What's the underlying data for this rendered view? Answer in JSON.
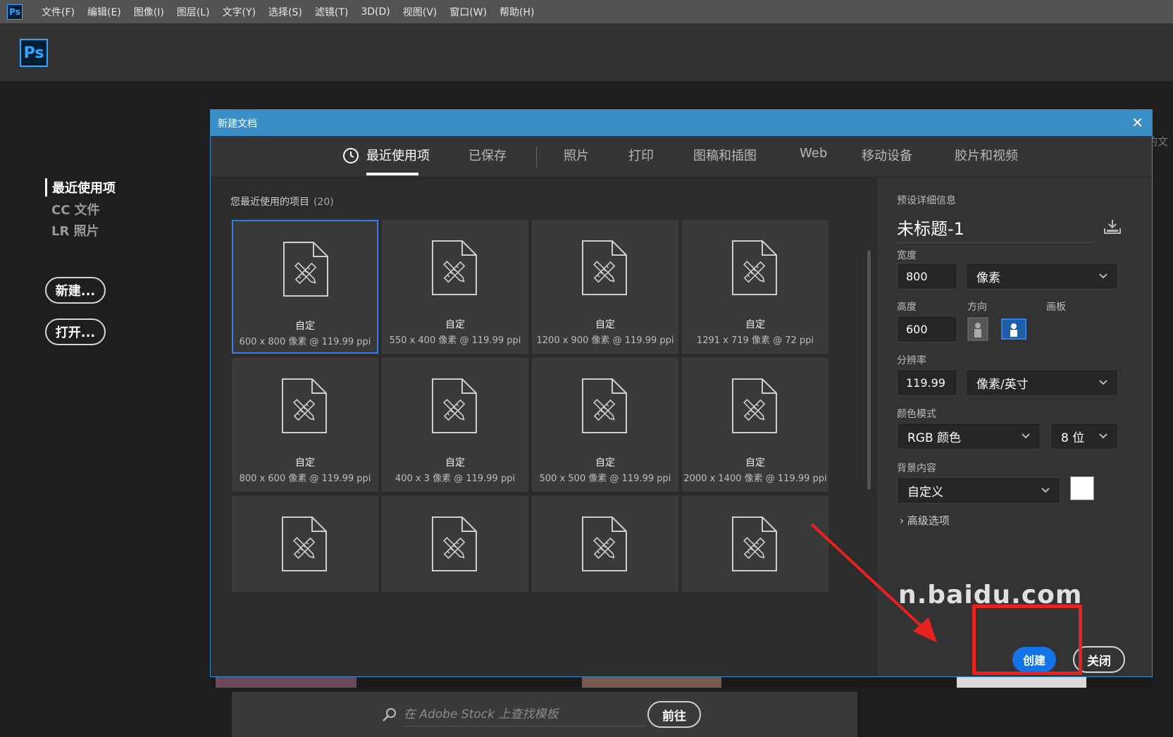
{
  "menubar": {
    "logo": "Ps",
    "items": [
      "文件(F)",
      "编辑(E)",
      "图像(I)",
      "图层(L)",
      "文字(Y)",
      "选择(S)",
      "滤镜(T)",
      "3D(D)",
      "视图(V)",
      "窗口(W)",
      "帮助(H)"
    ]
  },
  "header": {
    "logo": "Ps"
  },
  "start_panel": {
    "nav": [
      "最近使用项",
      "CC 文件",
      "LR 照片"
    ],
    "new_button": "新建...",
    "open_button": "打开..."
  },
  "background": {
    "right_fragment": "的文"
  },
  "dialog": {
    "title": "新建文档",
    "close_glyph": "✕",
    "tabs": [
      "最近使用项",
      "已保存",
      "照片",
      "打印",
      "图稿和插图",
      "Web",
      "移动设备",
      "胶片和视频"
    ],
    "active_tab": 0,
    "recent": {
      "heading": "您最近使用的项目",
      "count": "(20)",
      "items": [
        {
          "name": "自定",
          "size": "600 x 800 像素 @ 119.99 ppi",
          "selected": true
        },
        {
          "name": "自定",
          "size": "550 x 400 像素 @ 119.99 ppi"
        },
        {
          "name": "自定",
          "size": "1200 x 900 像素 @ 119.99 ppi"
        },
        {
          "name": "自定",
          "size": "1291 x 719 像素 @ 72 ppi"
        },
        {
          "name": "自定",
          "size": "800 x 600 像素 @ 119.99 ppi"
        },
        {
          "name": "自定",
          "size": "400 x 3 像素 @ 119.99 ppi"
        },
        {
          "name": "自定",
          "size": "500 x 500 像素 @ 119.99 ppi"
        },
        {
          "name": "自定",
          "size": "2000 x 1400 像素 @ 119.99 ppi"
        },
        {
          "name": "",
          "size": ""
        },
        {
          "name": "",
          "size": ""
        },
        {
          "name": "",
          "size": ""
        },
        {
          "name": "",
          "size": ""
        }
      ]
    },
    "stock": {
      "placeholder": "在 Adobe Stock 上查找模板",
      "go_button": "前往"
    },
    "details": {
      "section_label": "预设详细信息",
      "preset_name": "未标题-1",
      "width_label": "宽度",
      "width_value": "800",
      "width_unit": "像素",
      "height_label": "高度",
      "height_value": "600",
      "orientation_label": "方向",
      "artboard_label": "画板",
      "resolution_label": "分辨率",
      "resolution_value": "119.99",
      "resolution_unit": "像素/英寸",
      "color_mode_label": "颜色模式",
      "color_mode": "RGB 颜色",
      "bit_depth": "8 位",
      "background_label": "背景内容",
      "background_value": "自定义",
      "background_color": "#ffffff",
      "advanced_label": "高级选项",
      "create_button": "创建",
      "close_button": "关闭"
    }
  },
  "overlay": {
    "watermark": "n.baidu.com",
    "highlight_color": "#e8231f"
  },
  "colors": {
    "accent": "#1473e6",
    "titlebar": "#3a90c6",
    "ps_blue": "#31a8ff"
  }
}
